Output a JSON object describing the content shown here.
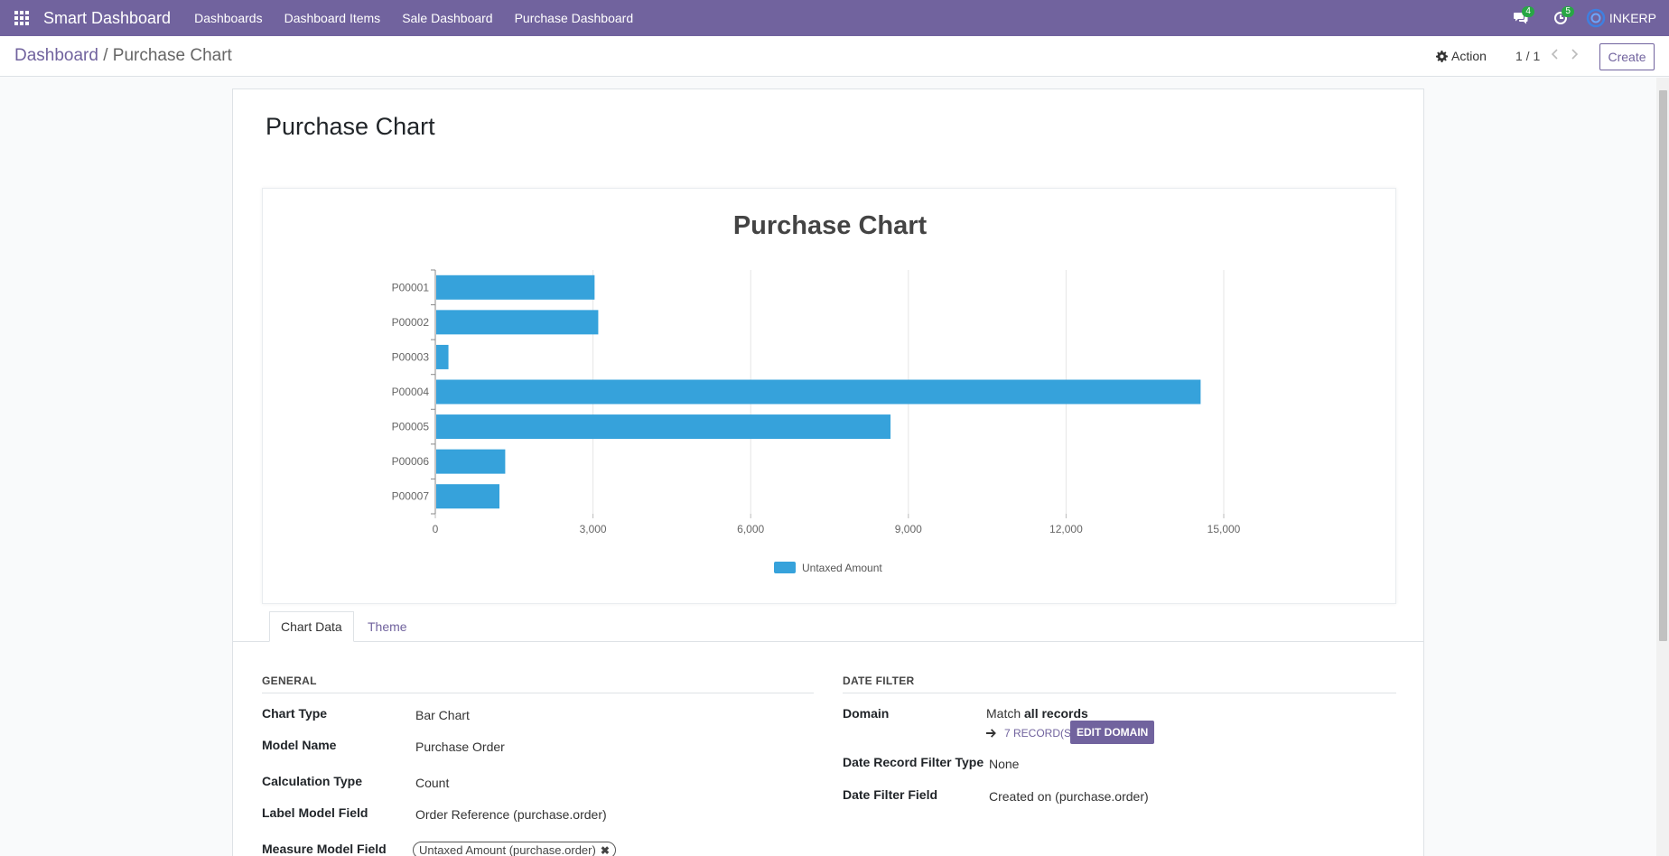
{
  "navbar": {
    "brand": "Smart Dashboard",
    "menu": [
      "Dashboards",
      "Dashboard Items",
      "Sale Dashboard",
      "Purchase Dashboard"
    ],
    "messages_count": "4",
    "activities_count": "5",
    "user_name": "INKERP",
    "accent_color": "#71639e"
  },
  "control_panel": {
    "breadcrumb_parent": "Dashboard",
    "breadcrumb_sep": "/",
    "breadcrumb_current": "Purchase Chart",
    "action_label": "Action",
    "pager": "1 / 1",
    "create_label": "Create"
  },
  "record": {
    "title": "Purchase Chart"
  },
  "chart_data": {
    "type": "bar",
    "orientation": "horizontal",
    "title": "Purchase Chart",
    "categories": [
      "P00001",
      "P00002",
      "P00003",
      "P00004",
      "P00005",
      "P00006",
      "P00007"
    ],
    "series": [
      {
        "name": "Untaxed Amount",
        "values": [
          3030,
          3100,
          250,
          14560,
          8660,
          1330,
          1220
        ],
        "color": "#36a2db"
      }
    ],
    "x_ticks": [
      "0",
      "3,000",
      "6,000",
      "9,000",
      "12,000",
      "15,000"
    ],
    "xlim": [
      0,
      15000
    ],
    "grid": true,
    "legend_position": "bottom"
  },
  "tabs": [
    "Chart Data",
    "Theme"
  ],
  "general": {
    "heading": "GENERAL",
    "chart_type_label": "Chart Type",
    "chart_type_value": "Bar Chart",
    "model_name_label": "Model Name",
    "model_name_value": "Purchase Order",
    "calc_type_label": "Calculation Type",
    "calc_type_value": "Count",
    "label_field_label": "Label Model Field",
    "label_field_value": "Order Reference (purchase.order)",
    "measure_field_label": "Measure Model Field",
    "measure_field_tag": "Untaxed Amount (purchase.order)"
  },
  "date_filter": {
    "heading": "DATE FILTER",
    "domain_label": "Domain",
    "domain_prefix": "Match ",
    "domain_bold": "all records",
    "records_link": "7 RECORD(S)",
    "edit_domain_label": "EDIT DOMAIN",
    "record_filter_type_label": "Date Record Filter Type",
    "record_filter_type_value": "None",
    "filter_field_label": "Date Filter Field",
    "filter_field_value": "Created on (purchase.order)"
  }
}
